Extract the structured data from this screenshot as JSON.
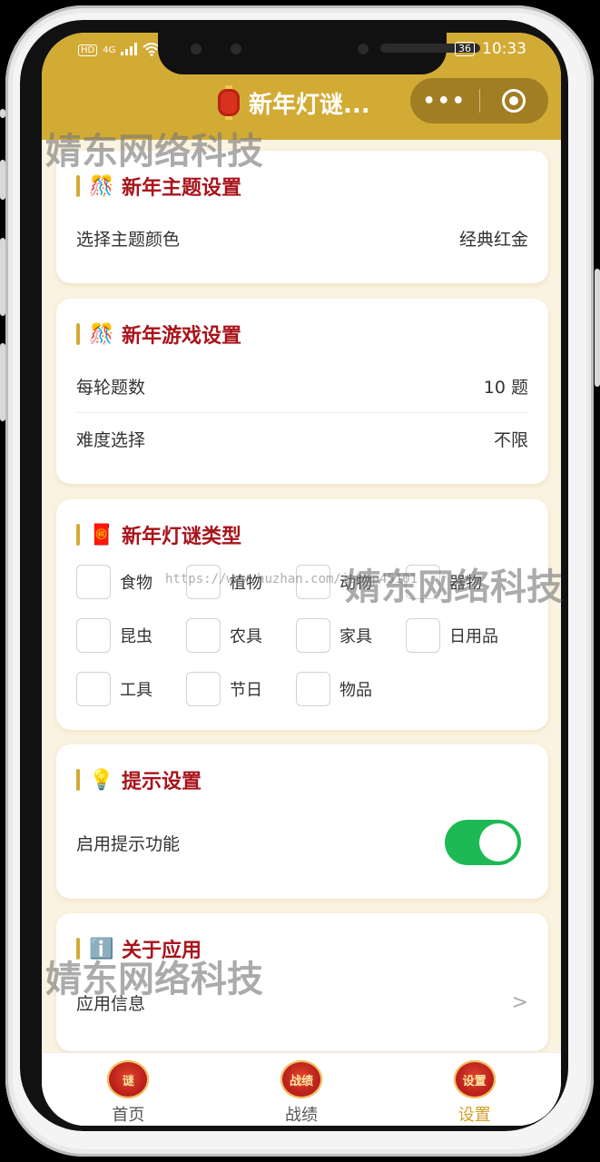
{
  "status_bar": {
    "left_icons": [
      "HD",
      "4G",
      "signal-icon",
      "wifi-icon"
    ],
    "battery": "36",
    "time": "10:33"
  },
  "nav": {
    "title": "新年灯谜...",
    "icon": "lantern-icon"
  },
  "sections": {
    "theme": {
      "icon": "🎊",
      "title": "新年主题设置",
      "row_label": "选择主题颜色",
      "row_value": "经典红金"
    },
    "game": {
      "icon": "🎊",
      "title": "新年游戏设置",
      "rows": [
        {
          "label": "每轮题数",
          "value": "10 题"
        },
        {
          "label": "难度选择",
          "value": "不限"
        }
      ]
    },
    "types": {
      "icon": "🧧",
      "title": "新年灯谜类型",
      "options": [
        "食物",
        "植物",
        "动物",
        "器物",
        "昆虫",
        "农具",
        "家具",
        "日用品",
        "工具",
        "节日",
        "物品"
      ]
    },
    "hints": {
      "icon": "💡",
      "title": "提示设置",
      "row_label": "启用提示功能",
      "enabled": true
    },
    "about": {
      "icon": "ℹ️",
      "title": "关于应用",
      "row_label": "应用信息",
      "chevron": ">"
    }
  },
  "tabbar": {
    "tabs": [
      {
        "label": "首页",
        "badge": "谜",
        "active": false
      },
      {
        "label": "战绩",
        "badge": "战绩",
        "active": false
      },
      {
        "label": "设置",
        "badge": "设置",
        "active": true
      }
    ]
  },
  "watermark": {
    "text": "婧东网络科技",
    "url": "https://www.huzhan.com/ishop45101"
  },
  "colors": {
    "accent_gold": "#d2ab35",
    "title_red": "#a8141b",
    "toggle_green": "#1db954",
    "background": "#fbf3e1"
  }
}
